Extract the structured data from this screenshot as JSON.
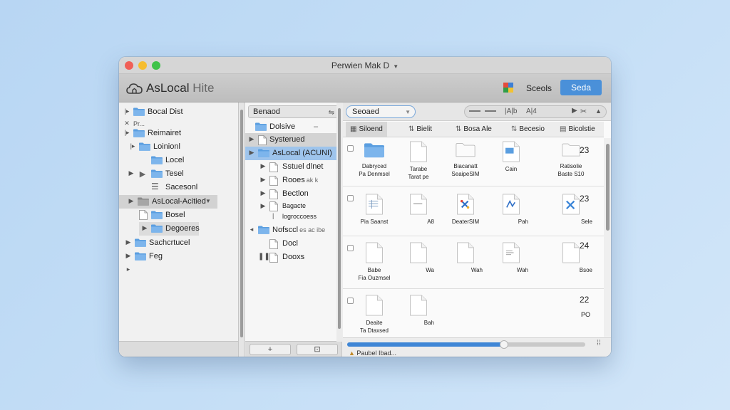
{
  "window": {
    "title": "Perwien Mak D"
  },
  "toolbar": {
    "app_title_main": "AsLocal",
    "app_title_dim": "Hite",
    "sub_label": "Sceols",
    "action_button": "Seda"
  },
  "sidebar": {
    "items": [
      {
        "label": "Bocal Dist"
      },
      {
        "label": "Pr..."
      },
      {
        "label": "Reimairet"
      },
      {
        "label": "Loinionl"
      },
      {
        "label": "Locel"
      },
      {
        "label": "Tesel"
      },
      {
        "label": "Sacesonl"
      },
      {
        "label": "AsLocal-Acitied"
      },
      {
        "label": "Bosel"
      },
      {
        "label": "Degoeres"
      },
      {
        "label": "Sachcrtucel"
      },
      {
        "label": "Feg"
      }
    ]
  },
  "midpane": {
    "search_text": "Benaod",
    "items": [
      {
        "label": "Dolsive"
      },
      {
        "label": "Systerued"
      },
      {
        "label": "AsLocal (ACUNI)"
      },
      {
        "label": "Sstuel dlnet"
      },
      {
        "label": "Rooes",
        "sub": "ak k"
      },
      {
        "label": "Bectlon"
      },
      {
        "label": "Bagacte"
      },
      {
        "label": "logroccoess"
      },
      {
        "label": "Nofsccl",
        "sub": "es ac ibe"
      },
      {
        "label": "Docl"
      },
      {
        "label": "Dooxs"
      }
    ]
  },
  "rightpane": {
    "search_text": "Seoaed",
    "controls": [
      "|A|b",
      "A|4"
    ],
    "columns": [
      "Siloend",
      "Bielit",
      "Bosa Ale",
      "Becesio",
      "Bicolstie"
    ],
    "rows": [
      {
        "items": [
          {
            "label": "Dabryced",
            "label2": "Pa Denmsel"
          },
          {
            "label": "Tarabe",
            "label2": "Tarat pe"
          },
          {
            "label": "Biacanatt",
            "label2": "SeaipeSIM"
          },
          {
            "label": "Cain"
          },
          {
            "label": "Ratisolie",
            "label2": "Baste S10",
            "num": "23"
          }
        ]
      },
      {
        "items": [
          {
            "label": "Pia Saanst"
          },
          {
            "label": "A8"
          },
          {
            "label": "DeaterSIM"
          },
          {
            "label": "Pah"
          },
          {
            "label": "Sele",
            "num": "23"
          }
        ]
      },
      {
        "items": [
          {
            "label": "Babe",
            "label2": "Fia Ouzmsel"
          },
          {
            "label": "Wa"
          },
          {
            "label": "Wah"
          },
          {
            "label": "Wah"
          },
          {
            "label": "Bsoe",
            "num": "24"
          }
        ]
      },
      {
        "items": [
          {
            "label": "Deaite",
            "label2": "Ta Dtaxsed"
          },
          {
            "label": "Bah"
          },
          {
            "label": "PO",
            "num": "22"
          }
        ]
      }
    ],
    "progress": 0.66,
    "status": "Paubel Ibad..."
  },
  "colors": {
    "accent": "#4a90d9",
    "selection": "#9ec4ec",
    "folder": "#5a9ee0"
  }
}
